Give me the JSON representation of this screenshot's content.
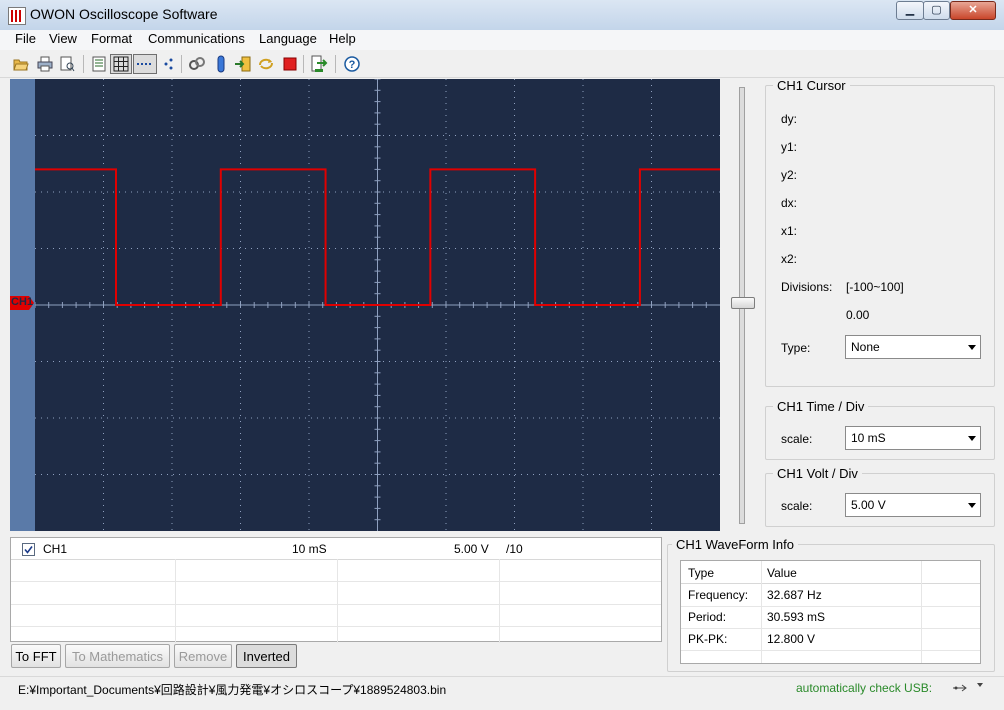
{
  "window": {
    "title": "OWON Oscilloscope Software"
  },
  "menu": [
    "File",
    "View",
    "Format",
    "Communications",
    "Language",
    "Help"
  ],
  "toolbar": {
    "icons": [
      "open-folder-icon",
      "print-icon",
      "print-preview-icon",
      "list-icon",
      "grid-icon",
      "dotted-line-icon",
      "dots-icon",
      "link-icon",
      "connect-icon",
      "import-icon",
      "refresh-icon",
      "stop-icon",
      "export-icon",
      "help-icon"
    ]
  },
  "scope": {
    "channel_marker": "CH1",
    "waveform": {
      "color": "#e00000",
      "type": "square",
      "high_div": 2.4,
      "low_div": 0
    },
    "colors": {
      "background": "#1e2b45",
      "grid": "#8fa0bf",
      "trace": "#e00000"
    }
  },
  "cursor": {
    "title": "CH1 Cursor",
    "dy": "dy:",
    "y1": "y1:",
    "y2": "y2:",
    "dx": "dx:",
    "x1": "x1:",
    "x2": "x2:",
    "divisions_label": "Divisions:",
    "divisions_range": "[-100~100]",
    "divisions_value": "0.00",
    "type_label": "Type:",
    "type_value": "None"
  },
  "time_div": {
    "title": "CH1 Time / Div",
    "scale_label": "scale:",
    "value": "10 mS"
  },
  "volt_div": {
    "title": "CH1 Volt / Div",
    "scale_label": "scale:",
    "value": "5.00 V"
  },
  "channel_table": {
    "row": {
      "checked": true,
      "name": "CH1",
      "time": "10 mS",
      "volt": "5.00 V",
      "probe": "/10"
    }
  },
  "buttons": {
    "fft": "To FFT",
    "math": "To Mathematics",
    "remove": "Remove",
    "inverted": "Inverted"
  },
  "waveform_info": {
    "title": "CH1 WaveForm Info",
    "headers": [
      "Type",
      "Value"
    ],
    "rows": [
      {
        "type": "Frequency:",
        "value": "32.687 Hz"
      },
      {
        "type": "Period:",
        "value": "30.593 mS"
      },
      {
        "type": "PK-PK:",
        "value": "12.800 V"
      }
    ]
  },
  "status": {
    "path": "E:¥Important_Documents¥回路設計¥風力発電¥オシロスコープ¥1889524803.bin",
    "usb": "automatically check USB:",
    "usb_color": "#2a8a2a"
  }
}
